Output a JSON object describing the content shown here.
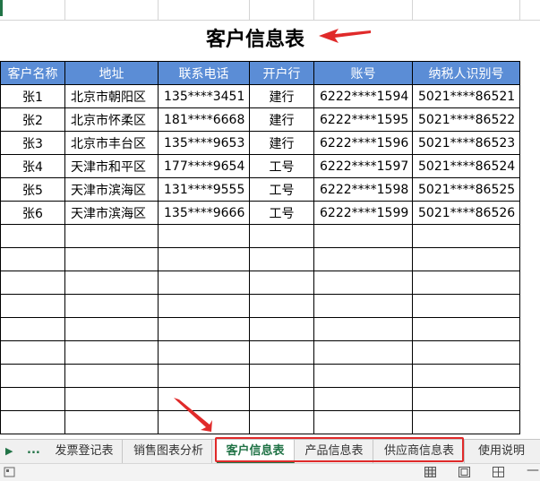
{
  "title": "客户信息表",
  "table": {
    "headers": [
      "客户名称",
      "地址",
      "联系电话",
      "开户行",
      "账号",
      "纳税人识别号"
    ],
    "rows": [
      [
        "张1",
        "北京市朝阳区",
        "135****3451",
        "建行",
        "6222****1594",
        "5021****86521"
      ],
      [
        "张2",
        "北京市怀柔区",
        "181****6668",
        "建行",
        "6222****1595",
        "5021****86522"
      ],
      [
        "张3",
        "北京市丰台区",
        "135****9653",
        "建行",
        "6222****1596",
        "5021****86523"
      ],
      [
        "张4",
        "天津市和平区",
        "177****9654",
        "工号",
        "6222****1597",
        "5021****86524"
      ],
      [
        "张5",
        "天津市滨海区",
        "131****9555",
        "工号",
        "6222****1598",
        "5021****86525"
      ],
      [
        "张6",
        "天津市滨海区",
        "135****9666",
        "工号",
        "6222****1599",
        "5021****86526"
      ]
    ],
    "empty_rows": 9
  },
  "tabs": {
    "ellipsis": "...",
    "items": [
      "发票登记表",
      "销售图表分析",
      "客户信息表",
      "产品信息表",
      "供应商信息表",
      "使用说明"
    ],
    "active": "客户信息表"
  },
  "colors": {
    "header_bg": "#5b8dd6",
    "accent": "#217346",
    "annotation": "#e02a2a"
  },
  "icons": {
    "nav": "play-right-icon",
    "view_normal": "grid-view-icon",
    "view_page_layout": "page-layout-icon",
    "view_page_break": "page-break-icon"
  }
}
